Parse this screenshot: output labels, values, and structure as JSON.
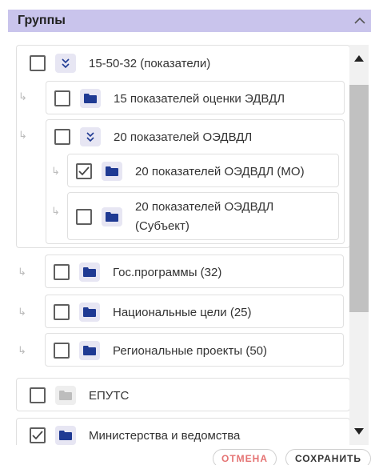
{
  "header": {
    "title": "Группы"
  },
  "items": [
    {
      "label": "15-50-32 (показатели)",
      "checked": false,
      "icon": "expand-toggle-icon"
    },
    {
      "label": "15 показателей оценки ЭДВДЛ",
      "checked": false,
      "icon": "folder-icon"
    },
    {
      "label": "20 показателей ОЭДВДЛ",
      "checked": false,
      "icon": "expand-toggle-icon"
    },
    {
      "label": "20 показателей ОЭДВДЛ (МО)",
      "checked": true,
      "icon": "folder-icon"
    },
    {
      "label": "20 показателей ОЭДВДЛ (Субъект)",
      "checked": false,
      "icon": "folder-icon"
    },
    {
      "label": "Гос.программы (32)",
      "checked": false,
      "icon": "folder-icon"
    },
    {
      "label": "Национальные цели (25)",
      "checked": false,
      "icon": "folder-icon"
    },
    {
      "label": "Региональные проекты (50)",
      "checked": false,
      "icon": "folder-icon"
    },
    {
      "label": "ЕПУТС",
      "checked": false,
      "icon": "folder-icon-grey"
    },
    {
      "label": "Министерства и ведомства",
      "checked": true,
      "icon": "folder-icon"
    }
  ],
  "footer": {
    "cancel_label": "ОТМЕНА",
    "save_label": "СОХРАНИТЬ"
  },
  "colors": {
    "header_bg": "#c9c4ec",
    "folder": "#1f3a93",
    "cancel": "#e57373"
  }
}
